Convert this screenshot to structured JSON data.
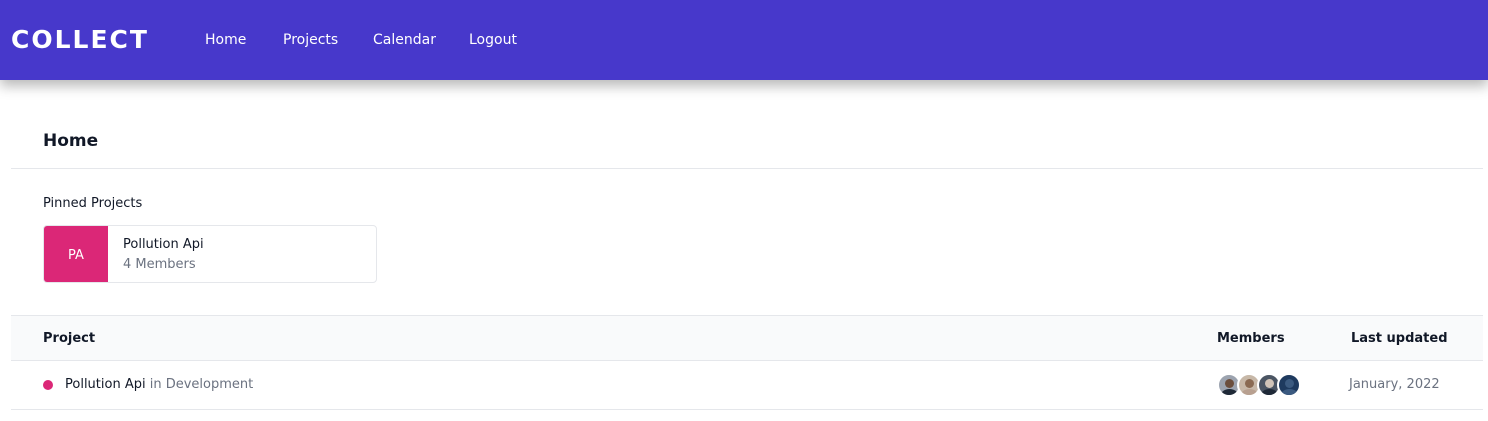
{
  "app": {
    "brand": "COLLECT",
    "nav": [
      {
        "label": "Home"
      },
      {
        "label": "Projects"
      },
      {
        "label": "Calendar"
      },
      {
        "label": "Logout"
      }
    ]
  },
  "page": {
    "title": "Home",
    "pinned_heading": "Pinned Projects"
  },
  "pinned_projects": [
    {
      "initials": "PA",
      "name": "Pollution Api",
      "members": "4 Members",
      "color": "#db2777"
    }
  ],
  "table": {
    "headers": {
      "project": "Project",
      "members": "Members",
      "last_updated": "Last updated"
    },
    "rows": [
      {
        "name": "Pollution Api",
        "stage_prefix": "in",
        "stage": "Development",
        "status_color": "#db2777",
        "member_avatars": [
          "avatar-1",
          "avatar-2",
          "avatar-3",
          "avatar-4"
        ],
        "last_updated": "January, 2022"
      }
    ]
  },
  "colors": {
    "header_bg": "#4738cb",
    "accent_pink": "#db2777"
  }
}
